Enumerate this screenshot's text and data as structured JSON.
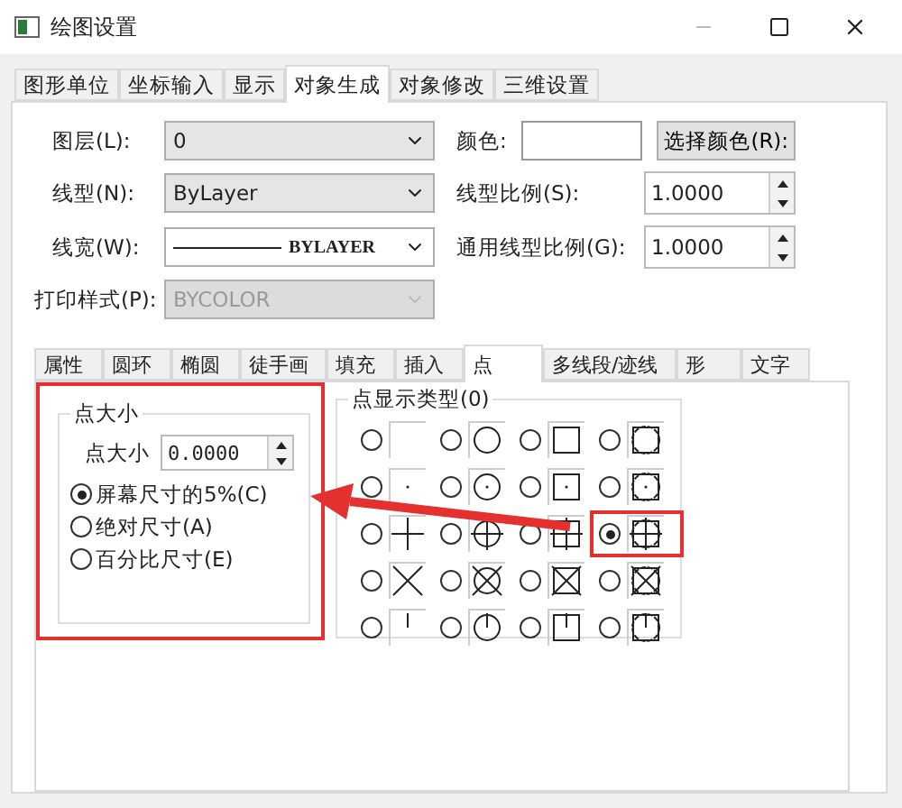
{
  "window": {
    "title": "绘图设置"
  },
  "tabs": [
    {
      "label": "图形单位",
      "selected": false
    },
    {
      "label": "坐标输入",
      "selected": false
    },
    {
      "label": "显示",
      "selected": false
    },
    {
      "label": "对象生成",
      "selected": true
    },
    {
      "label": "对象修改",
      "selected": false
    },
    {
      "label": "三维设置",
      "selected": false
    }
  ],
  "fields": {
    "layer": {
      "label": "图层(L):",
      "value": "0"
    },
    "linetype": {
      "label": "线型(N):",
      "value": "ByLayer"
    },
    "lineweight": {
      "label": "线宽(W):",
      "value": "BYLAYER"
    },
    "plot_style": {
      "label": "打印样式(P):",
      "value": "BYCOLOR",
      "disabled": true
    },
    "color": {
      "label": "颜色:"
    },
    "color_button": "选择颜色(R):",
    "linetype_scale": {
      "label": "线型比例(S):",
      "value": "1.0000"
    },
    "global_scale": {
      "label": "通用线型比例(G):",
      "value": "1.0000"
    }
  },
  "subtabs": [
    {
      "label": "属性",
      "selected": false
    },
    {
      "label": "圆环",
      "selected": false
    },
    {
      "label": "椭圆",
      "selected": false
    },
    {
      "label": "徒手画",
      "selected": false
    },
    {
      "label": "填充",
      "selected": false
    },
    {
      "label": "插入",
      "selected": false
    },
    {
      "label": "点",
      "selected": true
    },
    {
      "label": "多线段/迹线",
      "selected": false
    },
    {
      "label": "形",
      "selected": false
    },
    {
      "label": "文字",
      "selected": false
    }
  ],
  "point_size": {
    "title": "点大小",
    "size_label": "点大小",
    "size_value": "0.0000",
    "modes": [
      {
        "label": "屏幕尺寸的5%(C)",
        "selected": true
      },
      {
        "label": "绝对尺寸(A)",
        "selected": false
      },
      {
        "label": "百分比尺寸(E)",
        "selected": false
      }
    ]
  },
  "point_type": {
    "title": "点显示类型(0)",
    "cells": [
      {
        "selected": false
      },
      {
        "selected": false
      },
      {
        "selected": false
      },
      {
        "selected": false
      },
      {
        "selected": false
      },
      {
        "selected": false
      },
      {
        "selected": false
      },
      {
        "selected": false
      },
      {
        "selected": false
      },
      {
        "selected": false
      },
      {
        "selected": false
      },
      {
        "selected": true
      },
      {
        "selected": false
      },
      {
        "selected": false
      },
      {
        "selected": false
      },
      {
        "selected": false
      },
      {
        "selected": false
      },
      {
        "selected": false
      },
      {
        "selected": false
      },
      {
        "selected": false
      }
    ]
  }
}
